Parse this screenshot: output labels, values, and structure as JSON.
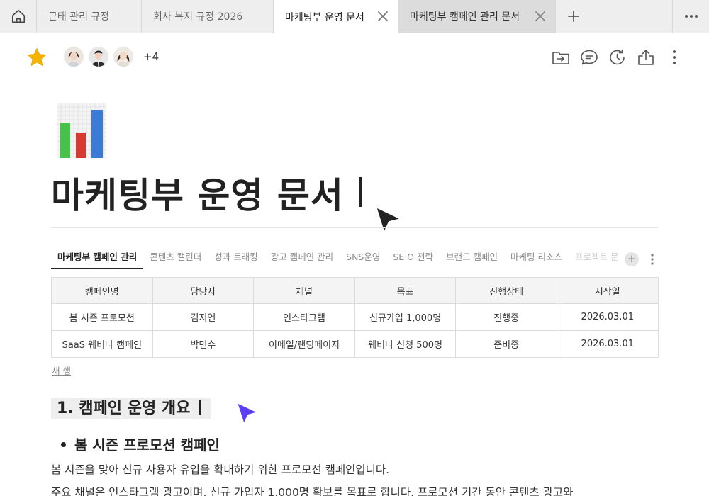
{
  "tabs": [
    {
      "label": "근태 관리 규정"
    },
    {
      "label": "회사 복지 규정 2026"
    },
    {
      "label": "마케팅부 운영 문서"
    },
    {
      "label": "마케팅부 캠페인 관리 문서"
    }
  ],
  "toolbar": {
    "collaborator_extra": "+4"
  },
  "document": {
    "title": "마케팅부 운영 문서"
  },
  "section_tabs": [
    {
      "label": "마케팅부 캠페인 관리"
    },
    {
      "label": "콘텐츠 캘린더"
    },
    {
      "label": "성과 트래킹"
    },
    {
      "label": "광고 캠페인 관리"
    },
    {
      "label": "SNS운영"
    },
    {
      "label": "SE O 전략"
    },
    {
      "label": "브랜드 캠페인"
    },
    {
      "label": "마케팅 리소스"
    },
    {
      "label": "프로젝트 문"
    }
  ],
  "table": {
    "headers": [
      "캠페인명",
      "담당자",
      "채널",
      "목표",
      "진행상태",
      "시작일"
    ],
    "rows": [
      [
        "봄 시즌 프로모션",
        "김지연",
        "인스타그램",
        "신규가입 1,000명",
        "진행중",
        "2026.03.01"
      ],
      [
        "SaaS 웨비나 캠페인",
        "박민수",
        "이메일/랜딩페이지",
        "웨비나 신청 500명",
        "준비중",
        "2026.03.01"
      ]
    ],
    "new_row_label": "새 행"
  },
  "content": {
    "heading1": "1. 캠페인 운영 개요",
    "bullet1": "봄 시즌 프로모션 캠페인",
    "para1": "봄 시즌을 맞아 신규 사용자 유입을 확대하기 위한 프로모션 캠페인입니다.",
    "para2": "주요 채널은 인스타그램 광고이며, 신규 가입자 1,000명 확보를 목표로 합니다. 프로모션 기간 동안 콘텐츠 광고와"
  },
  "colors": {
    "accent_pointer": "#5b3ff5",
    "star": "#f5b400"
  }
}
